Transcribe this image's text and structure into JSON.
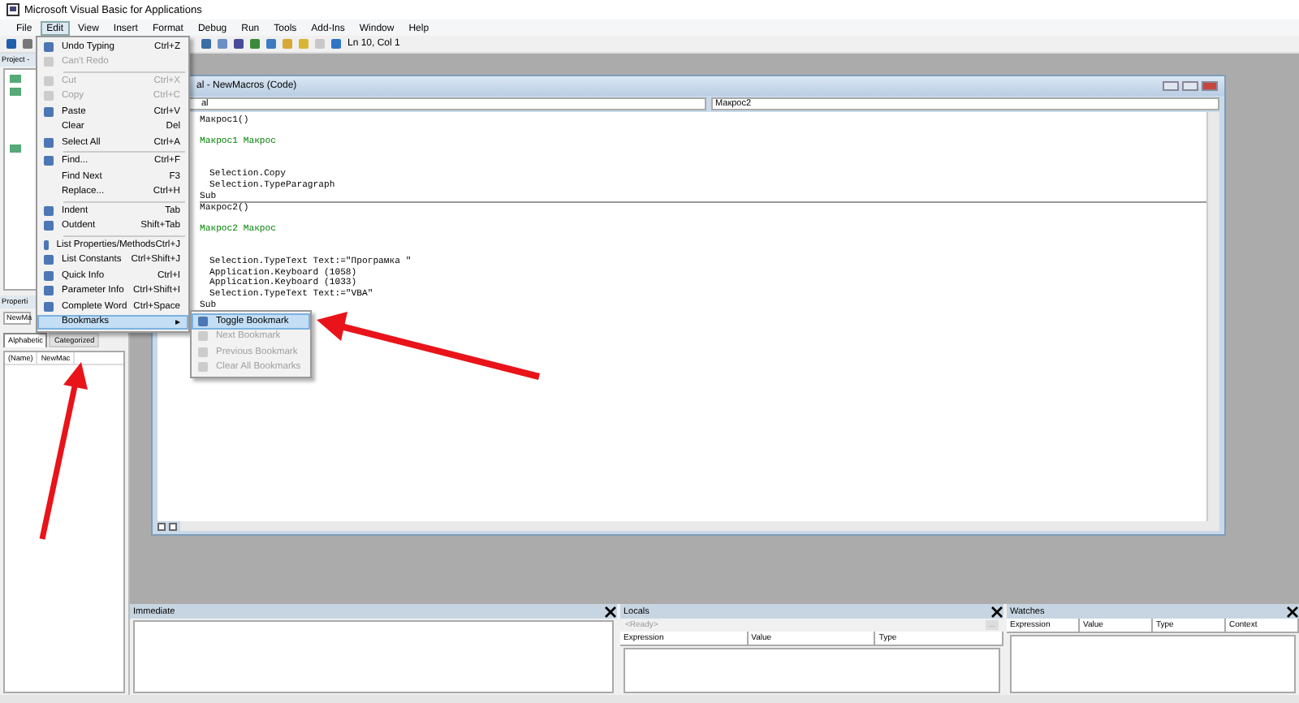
{
  "window": {
    "title": "Microsoft Visual Basic for Applications"
  },
  "menu_bar": [
    {
      "label": "File",
      "selected": false
    },
    {
      "label": "Edit",
      "selected": true
    },
    {
      "label": "View",
      "selected": false
    },
    {
      "label": "Insert",
      "selected": false
    },
    {
      "label": "Format",
      "selected": false
    },
    {
      "label": "Debug",
      "selected": false
    },
    {
      "label": "Run",
      "selected": false
    },
    {
      "label": "Tools",
      "selected": false
    },
    {
      "label": "Add-Ins",
      "selected": false
    },
    {
      "label": "Window",
      "selected": false
    },
    {
      "label": "Help",
      "selected": false
    }
  ],
  "toolbar": {
    "position": "Ln 10, Col 1"
  },
  "project_pane": {
    "title": "Project -"
  },
  "properties_pane": {
    "title": "Properti",
    "object": "NewMa",
    "tabs": [
      {
        "label": "Alphabetic",
        "selected": true
      },
      {
        "label": "Categorized",
        "selected": false
      }
    ],
    "rows": [
      {
        "name": "(Name)",
        "value": "NewMac"
      }
    ]
  },
  "code_window": {
    "title": "al - NewMacros (Code)",
    "object": "al",
    "procedure": "Макрос2",
    "lines": [
      {
        "kind": "header",
        "text": "Макрос1()"
      },
      {
        "kind": "blank"
      },
      {
        "kind": "comment",
        "text": "Макрос1 Макрос"
      },
      {
        "kind": "blank"
      },
      {
        "kind": "blank"
      },
      {
        "kind": "statement",
        "text": "Selection.Copy"
      },
      {
        "kind": "statement",
        "text": "Selection.TypeParagraph"
      },
      {
        "kind": "end",
        "text": "Sub"
      },
      {
        "kind": "header",
        "text": "Макрос2()"
      },
      {
        "kind": "blank"
      },
      {
        "kind": "comment",
        "text": "Макрос2 Макрос"
      },
      {
        "kind": "blank"
      },
      {
        "kind": "blank"
      },
      {
        "kind": "statement",
        "text": "Selection.TypeText Text:=\"Програмка \""
      },
      {
        "kind": "statement",
        "text": "Application.Keyboard (1058)"
      },
      {
        "kind": "statement",
        "text": "Application.Keyboard (1033)"
      },
      {
        "kind": "statement",
        "text": "Selection.TypeText Text:=\"VBA\""
      },
      {
        "kind": "header",
        "text": "Sub"
      }
    ]
  },
  "edit_menu": {
    "items": [
      {
        "kind": "item",
        "label": "Undo Typing",
        "shortcut": "Ctrl+Z",
        "disabled": false,
        "icon": true
      },
      {
        "kind": "item",
        "label": "Can't Redo",
        "disabled": true,
        "icon": true
      },
      {
        "kind": "separator"
      },
      {
        "kind": "item",
        "label": "Cut",
        "shortcut": "Ctrl+X",
        "disabled": true,
        "icon": true
      },
      {
        "kind": "item",
        "label": "Copy",
        "shortcut": "Ctrl+C",
        "disabled": true,
        "icon": true
      },
      {
        "kind": "item",
        "label": "Paste",
        "shortcut": "Ctrl+V",
        "disabled": false,
        "icon": true
      },
      {
        "kind": "item",
        "label": "Clear",
        "shortcut": "Del",
        "disabled": false,
        "icon": false
      },
      {
        "kind": "item",
        "label": "Select All",
        "shortcut": "Ctrl+A",
        "disabled": false,
        "icon": true
      },
      {
        "kind": "separator"
      },
      {
        "kind": "item",
        "label": "Find...",
        "shortcut": "Ctrl+F",
        "disabled": false,
        "icon": true
      },
      {
        "kind": "item",
        "label": "Find Next",
        "shortcut": "F3",
        "disabled": false,
        "icon": false
      },
      {
        "kind": "item",
        "label": "Replace...",
        "shortcut": "Ctrl+H",
        "disabled": false,
        "icon": false
      },
      {
        "kind": "separator"
      },
      {
        "kind": "item",
        "label": "Indent",
        "shortcut": "Tab",
        "disabled": false,
        "icon": true
      },
      {
        "kind": "item",
        "label": "Outdent",
        "shortcut": "Shift+Tab",
        "disabled": false,
        "icon": true
      },
      {
        "kind": "separator"
      },
      {
        "kind": "item",
        "label": "List Properties/Methods",
        "shortcut": "Ctrl+J",
        "disabled": false,
        "icon": true
      },
      {
        "kind": "item",
        "label": "List Constants",
        "shortcut": "Ctrl+Shift+J",
        "disabled": false,
        "icon": true
      },
      {
        "kind": "item",
        "label": "Quick Info",
        "shortcut": "Ctrl+I",
        "disabled": false,
        "icon": true
      },
      {
        "kind": "item",
        "label": "Parameter Info",
        "shortcut": "Ctrl+Shift+I",
        "disabled": false,
        "icon": true
      },
      {
        "kind": "item",
        "label": "Complete Word",
        "shortcut": "Ctrl+Space",
        "disabled": false,
        "icon": true
      },
      {
        "kind": "submenu",
        "label": "Bookmarks",
        "arrow": "▸",
        "disabled": false,
        "selected": true
      }
    ]
  },
  "bookmarks_submenu": {
    "items": [
      {
        "label": "Toggle Bookmark",
        "disabled": false,
        "selected": true
      },
      {
        "label": "Next Bookmark",
        "disabled": true,
        "selected": false
      },
      {
        "label": "Previous Bookmark",
        "disabled": true,
        "selected": false
      },
      {
        "label": "Clear All Bookmarks",
        "disabled": true,
        "selected": false
      }
    ]
  },
  "immediate": {
    "title": "Immediate"
  },
  "locals": {
    "title": "Locals",
    "status": "<Ready>",
    "button": "...",
    "columns": [
      "Expression",
      "Value",
      "Type"
    ]
  },
  "watches": {
    "title": "Watches",
    "columns": [
      "Expression",
      "Value",
      "Type",
      "Context"
    ]
  }
}
